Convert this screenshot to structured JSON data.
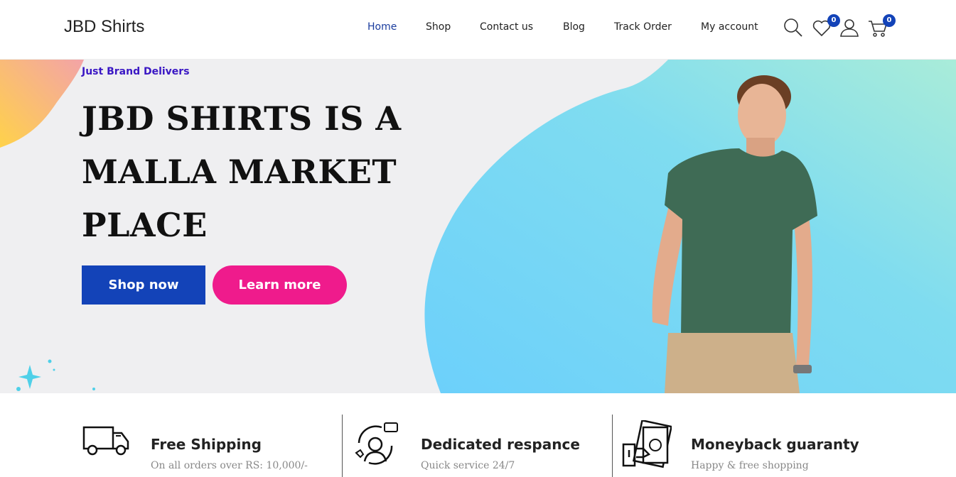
{
  "header": {
    "logo": "JBD Shirts",
    "nav": [
      {
        "label": "Home",
        "active": true
      },
      {
        "label": "Shop"
      },
      {
        "label": "Contact us"
      },
      {
        "label": "Blog"
      },
      {
        "label": "Track Order"
      },
      {
        "label": "My account"
      }
    ],
    "icons": [
      "search-icon",
      "heart-icon",
      "user-icon",
      "cart-icon"
    ],
    "wishlist_count": "0",
    "cart_count": "0"
  },
  "hero": {
    "tagline": "Just Brand Delivers",
    "headline": "JBD SHIRTS IS A MALLA MARKET PLACE",
    "shop_button": "Shop now",
    "learn_button": "Learn more"
  },
  "features": [
    {
      "icon": "truck-icon",
      "title": "Free Shipping",
      "subtitle": "On all orders over RS: 10,000/-"
    },
    {
      "icon": "support-agent-icon",
      "title": "Dedicated respance",
      "subtitle": "Quick service 24/7"
    },
    {
      "icon": "money-hand-icon",
      "title": "Moneyback guaranty",
      "subtitle": "Happy & free shopping"
    }
  ],
  "colors": {
    "primary": "#1343b8",
    "accent": "#ef1b8c",
    "tagline": "#3a17c4",
    "hero_bg": "#efeff1"
  }
}
